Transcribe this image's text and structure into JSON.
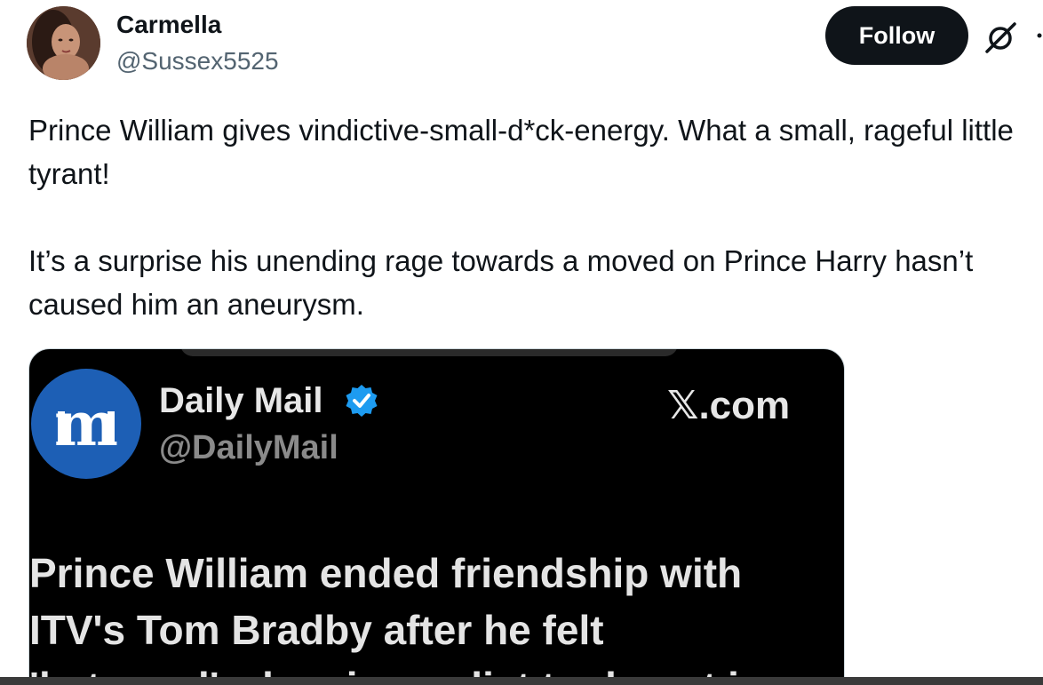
{
  "author": {
    "name": "Carmella",
    "handle": "@Sussex5525"
  },
  "actions": {
    "follow_label": "Follow"
  },
  "post": {
    "paragraph1": "Prince William gives vindictive-small-d*ck-energy. What a small, rageful little tyrant!",
    "paragraph2": "It’s a surprise his unending rage towards a moved on Prince Harry hasn’t caused him an aneurysm."
  },
  "media": {
    "source_name": "Daily Mail",
    "source_handle": "@DailyMail",
    "domain": "𝕏.com",
    "headline_lines": [
      "Prince William ended friendship with",
      "ITV's Tom Bradby after he felt",
      "'betrayed' when journalist took part in"
    ]
  },
  "colors": {
    "follow_bg": "#0f1419",
    "handle_text": "#536471",
    "verified": "#1d9bf0",
    "daily_mail_blue": "#1d5fb5"
  }
}
